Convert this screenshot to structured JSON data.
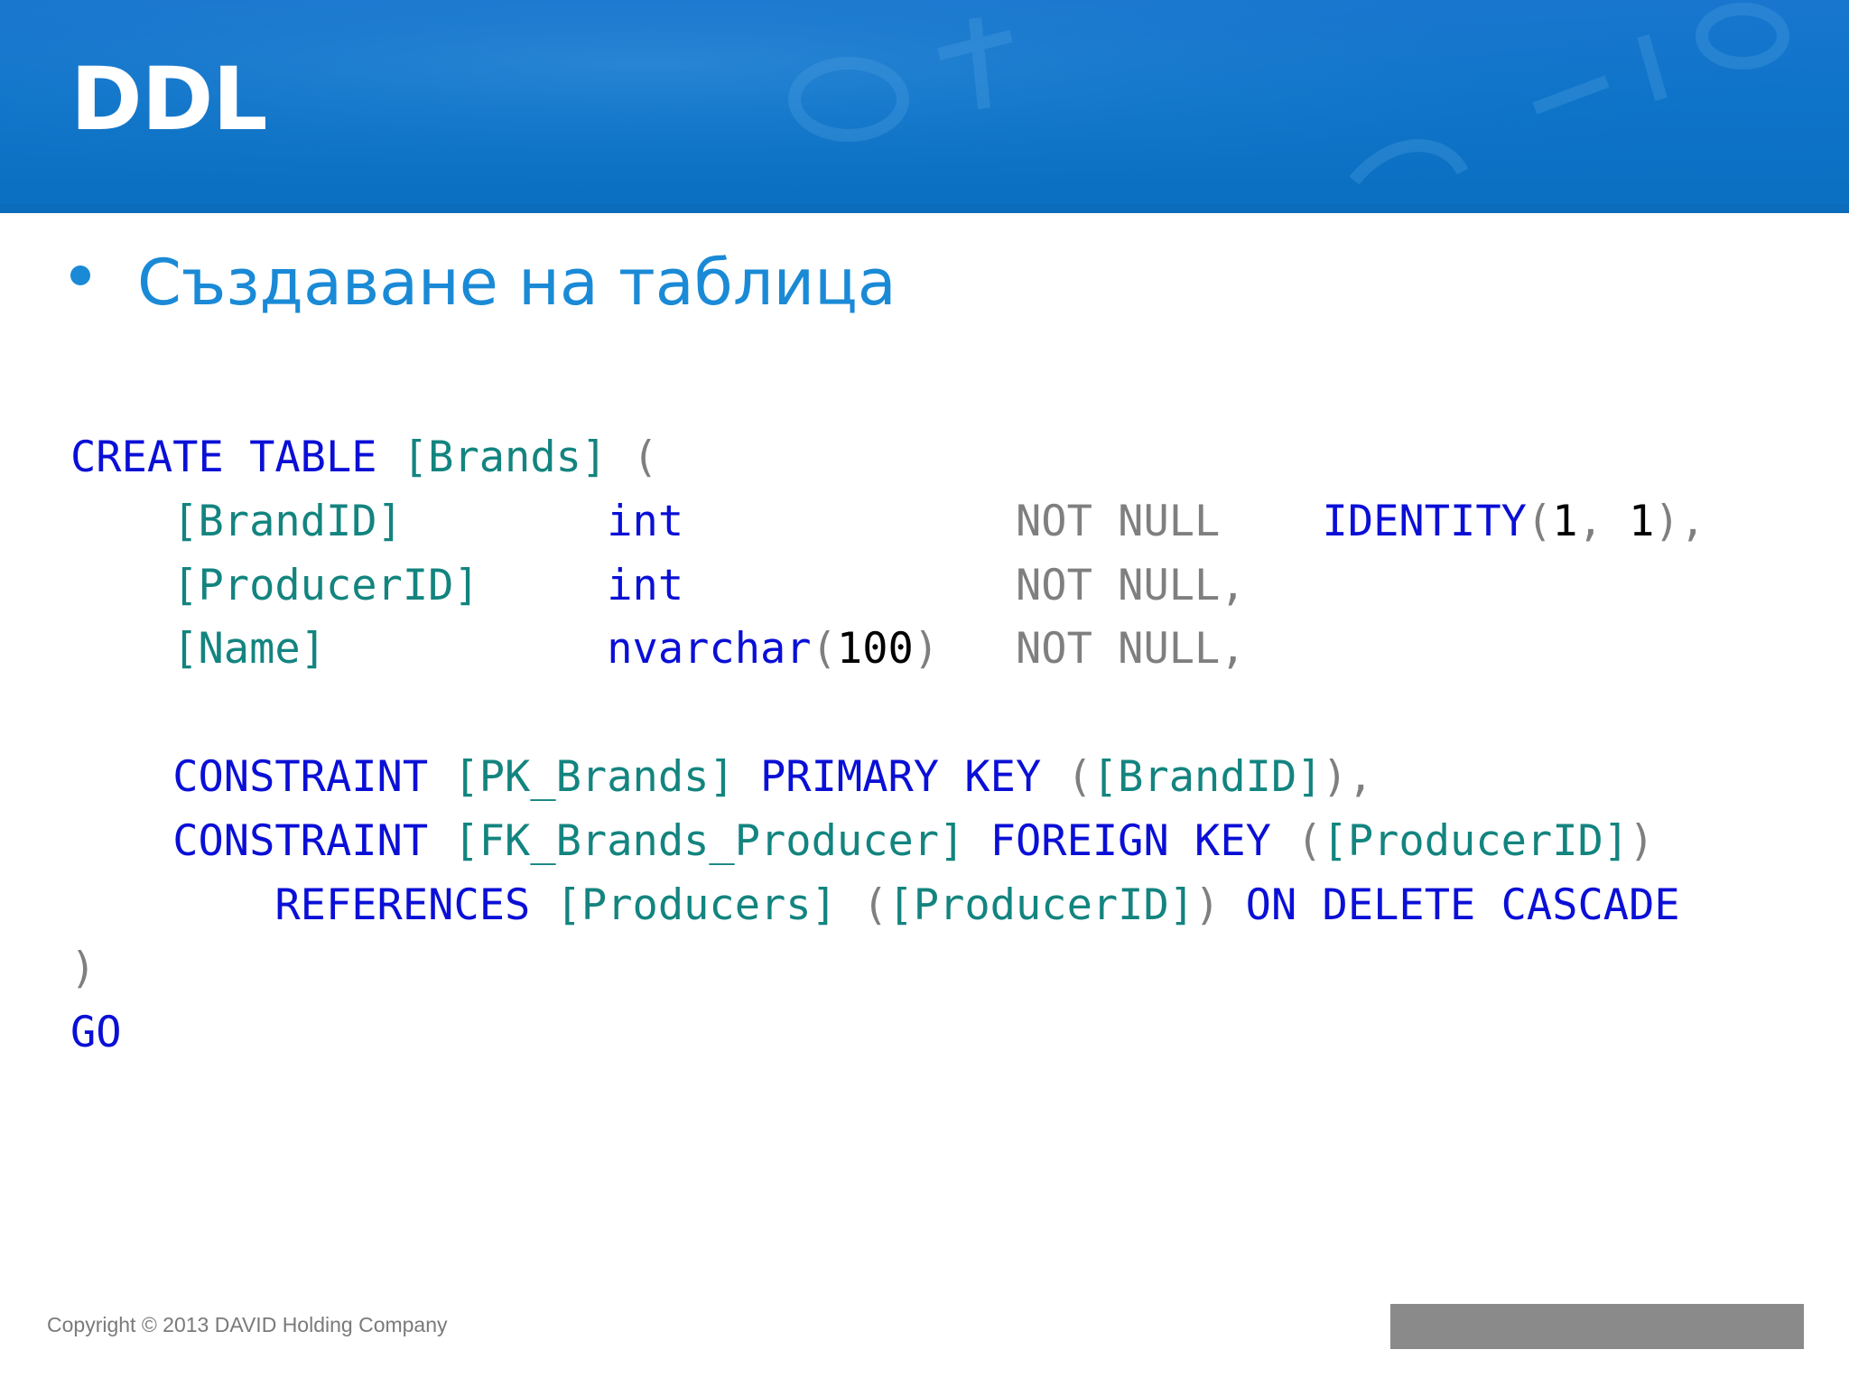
{
  "slide": {
    "title": "DDL",
    "bullet": "Създаване на таблица"
  },
  "code_lines": [
    [
      {
        "t": "CREATE TABLE",
        "c": "kw"
      },
      {
        "t": " "
      },
      {
        "t": "[Brands]",
        "c": "id"
      },
      {
        "t": " "
      },
      {
        "t": "(",
        "c": "gr"
      }
    ],
    [
      {
        "t": "    "
      },
      {
        "t": "[BrandID]",
        "c": "id"
      },
      {
        "t": "        "
      },
      {
        "t": "int",
        "c": "kw"
      },
      {
        "t": "             "
      },
      {
        "t": "NOT NULL",
        "c": "gr"
      },
      {
        "t": "    "
      },
      {
        "t": "IDENTITY",
        "c": "kw"
      },
      {
        "t": "(",
        "c": "gr"
      },
      {
        "t": "1",
        "c": "nm"
      },
      {
        "t": ", ",
        "c": "gr"
      },
      {
        "t": "1",
        "c": "nm"
      },
      {
        "t": "),",
        "c": "gr"
      }
    ],
    [
      {
        "t": "    "
      },
      {
        "t": "[ProducerID]",
        "c": "id"
      },
      {
        "t": "     "
      },
      {
        "t": "int",
        "c": "kw"
      },
      {
        "t": "             "
      },
      {
        "t": "NOT NULL,",
        "c": "gr"
      }
    ],
    [
      {
        "t": "    "
      },
      {
        "t": "[Name]",
        "c": "id"
      },
      {
        "t": "           "
      },
      {
        "t": "nvarchar",
        "c": "kw"
      },
      {
        "t": "(",
        "c": "gr"
      },
      {
        "t": "100",
        "c": "nm"
      },
      {
        "t": ")",
        "c": "gr"
      },
      {
        "t": "   "
      },
      {
        "t": "NOT NULL,",
        "c": "gr"
      }
    ],
    [],
    [
      {
        "t": "    "
      },
      {
        "t": "CONSTRAINT",
        "c": "kw"
      },
      {
        "t": " "
      },
      {
        "t": "[PK_Brands]",
        "c": "id"
      },
      {
        "t": " "
      },
      {
        "t": "PRIMARY KEY",
        "c": "kw"
      },
      {
        "t": " "
      },
      {
        "t": "(",
        "c": "gr"
      },
      {
        "t": "[BrandID]",
        "c": "id"
      },
      {
        "t": "),",
        "c": "gr"
      }
    ],
    [
      {
        "t": "    "
      },
      {
        "t": "CONSTRAINT",
        "c": "kw"
      },
      {
        "t": " "
      },
      {
        "t": "[FK_Brands_Producer]",
        "c": "id"
      },
      {
        "t": " "
      },
      {
        "t": "FOREIGN KEY",
        "c": "kw"
      },
      {
        "t": " "
      },
      {
        "t": "(",
        "c": "gr"
      },
      {
        "t": "[ProducerID]",
        "c": "id"
      },
      {
        "t": ")",
        "c": "gr"
      }
    ],
    [
      {
        "t": "        "
      },
      {
        "t": "REFERENCES",
        "c": "kw"
      },
      {
        "t": " "
      },
      {
        "t": "[Producers]",
        "c": "id"
      },
      {
        "t": " "
      },
      {
        "t": "(",
        "c": "gr"
      },
      {
        "t": "[ProducerID]",
        "c": "id"
      },
      {
        "t": ")",
        "c": "gr"
      },
      {
        "t": " "
      },
      {
        "t": "ON DELETE CASCADE",
        "c": "kw"
      }
    ],
    [
      {
        "t": ")",
        "c": "gr"
      }
    ],
    [
      {
        "t": "GO",
        "c": "kw"
      }
    ]
  ],
  "footer": {
    "copyright": "Copyright © 2013 DAVID Holding Company"
  },
  "colors": {
    "header_blue": "#0e74c9",
    "bullet_blue": "#1a8ad6",
    "sql_keyword": "#0a0fd6",
    "sql_identifier": "#13847f",
    "sql_operator": "#7f7f7f",
    "sql_number": "#000000",
    "footer_bar": "#8a8a8a"
  }
}
